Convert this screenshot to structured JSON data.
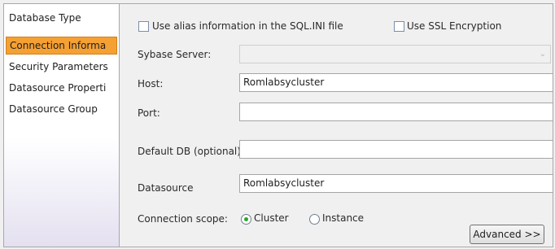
{
  "sidebar": {
    "items": [
      {
        "label": "Database Type",
        "active": false
      },
      {
        "label": "Connection Informa",
        "active": true
      },
      {
        "label": "Security Parameters",
        "active": false
      },
      {
        "label": "Datasource Properti",
        "active": false
      },
      {
        "label": "Datasource Group",
        "active": false
      }
    ]
  },
  "form": {
    "use_alias_label": "Use alias information in the SQL.INI file",
    "use_alias_checked": false,
    "use_ssl_label": "Use SSL Encryption",
    "use_ssl_checked": false,
    "sybase_server_label": "Sybase Server:",
    "sybase_server_value": "",
    "host_label": "Host:",
    "host_value": "Romlabsycluster",
    "port_label": "Port:",
    "port_value": "",
    "default_db_label": "Default DB (optional):",
    "default_db_value": "",
    "datasource_label": "Datasource",
    "datasource_value": "Romlabsycluster",
    "connection_scope_label": "Connection scope:",
    "scope_cluster_label": "Cluster",
    "scope_instance_label": "Instance",
    "scope_selected": "Cluster",
    "advanced_button": "Advanced >>"
  },
  "colors": {
    "active_item": "#f5a033",
    "radio_selected": "#2aa52a"
  }
}
